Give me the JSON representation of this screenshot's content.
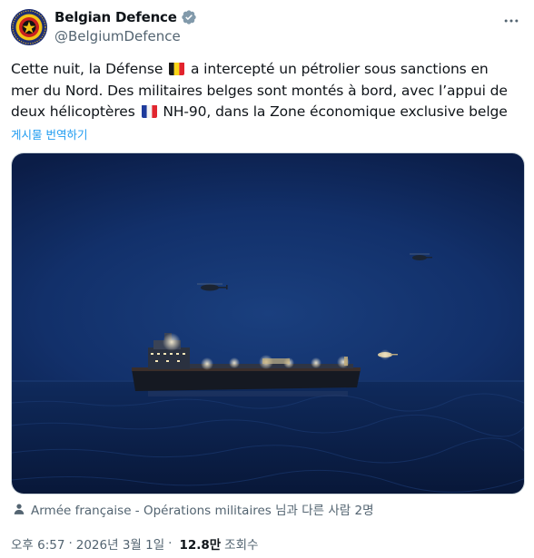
{
  "author": {
    "display_name": "Belgian Defence",
    "handle": "@BelgiumDefence",
    "verified_color": "#829aab"
  },
  "tweet": {
    "line1_part1": "Cette nuit, la  Défense",
    "line1_part2": "a intercepté un pétrolier sous sanctions en",
    "line2": "mer du Nord. Des militaires belges sont montés à bord, avec l’appui de",
    "line3_part1": "deux hélicoptères",
    "line3_part2": "NH-90, dans la Zone économique exclusive belge",
    "flags": [
      "belgium-flag",
      "france-flag"
    ],
    "translate_label": "게시물 번역하기"
  },
  "media": {
    "kind": "photo"
  },
  "tagged": {
    "text": "Armée française - Opérations militaires 님과 다른 사람 2명"
  },
  "meta": {
    "time": "오후 6:57",
    "date": "2026년 3월 1일",
    "views_count": "12.8만",
    "views_label": "조회수"
  },
  "colors": {
    "link": "#1d9bf0",
    "secondary_text": "#536471",
    "primary_text": "#0f1419"
  }
}
